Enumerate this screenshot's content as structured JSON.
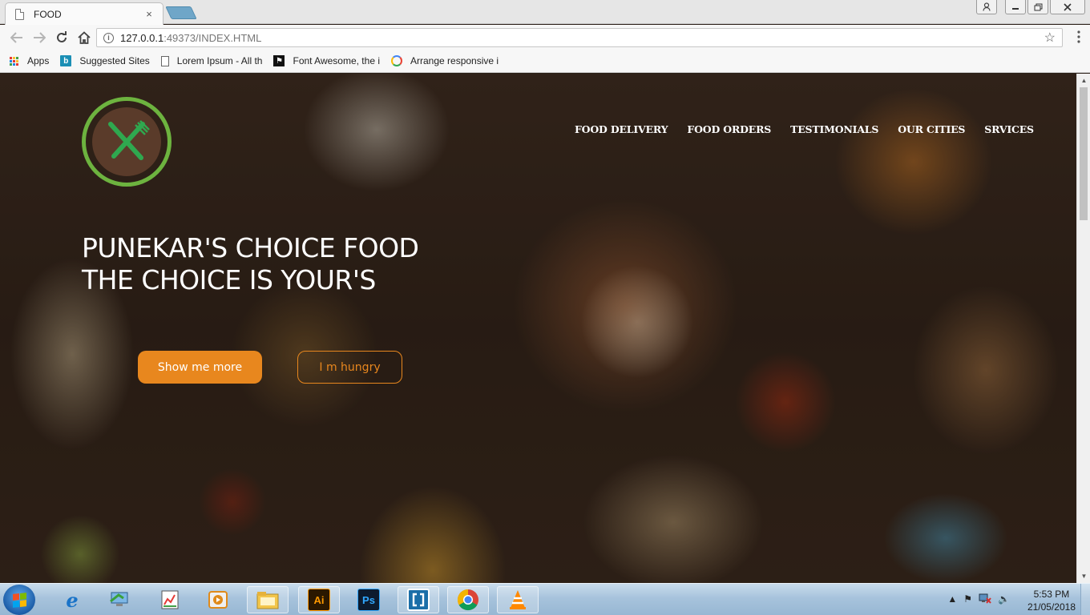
{
  "browser": {
    "tab_title": "FOOD",
    "tab_close": "×",
    "url_host": "127.0.0.1",
    "url_rest": ":49373/INDEX.HTML",
    "bookmarks": [
      {
        "label": "Apps",
        "icon": "apps-grid-icon"
      },
      {
        "label": "Suggested Sites",
        "icon": "bing-icon"
      },
      {
        "label": "Lorem Ipsum - All th",
        "icon": "document-icon"
      },
      {
        "label": "Font Awesome, the i",
        "icon": "flag-icon"
      },
      {
        "label": "Arrange responsive i",
        "icon": "google-icon"
      }
    ]
  },
  "site": {
    "nav": [
      "FOOD DELIVERY",
      "FOOD ORDERS",
      "TESTIMONIALS",
      "OUR CITIES",
      "SRVICES"
    ],
    "headline_line1": "PUNEKAR'S CHOICE FOOD",
    "headline_line2": "THE CHOICE IS YOUR'S",
    "primary_button": "Show me more",
    "secondary_button": "I m hungry",
    "colors": {
      "accent": "#e8871e",
      "logo_green": "#6db33f"
    }
  },
  "taskbar": {
    "apps": [
      "internet-explorer-icon",
      "computer-icon",
      "paint-icon",
      "media-player-icon",
      "file-explorer-icon",
      "illustrator-icon",
      "photoshop-icon",
      "brackets-icon",
      "chrome-icon",
      "vlc-icon"
    ],
    "illustrator_label": "Ai",
    "photoshop_label": "Ps",
    "time": "5:53 PM",
    "date": "21/05/2018"
  }
}
